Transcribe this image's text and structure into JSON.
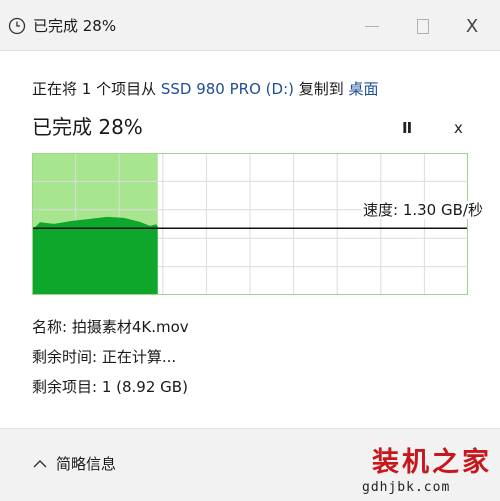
{
  "window": {
    "title": "已完成 28%",
    "minimize_icon": "minimize-icon",
    "maximize_icon": "maximize-icon",
    "close_glyph": "X"
  },
  "copy": {
    "prefix": "正在将 1 个项目从 ",
    "source": "SSD 980 PRO (D:)",
    "middle": " 复制到 ",
    "destination": "桌面"
  },
  "status": {
    "title": "已完成 28%",
    "pause_glyph": "II",
    "cancel_glyph": "x",
    "percent_complete": 28
  },
  "graph": {
    "speed_label": "速度: 1.30 GB/秒",
    "fill_color": "#0fa72b",
    "history_color": "#a8e58f",
    "current_speed_level": 0.47,
    "history_peak_level": 0.55
  },
  "details": {
    "name_label": "名称: ",
    "name_value": "拍摄素材4K.mov",
    "time_label": "剩余时间: ",
    "time_value": "正在计算...",
    "items_label": "剩余项目: ",
    "items_value": "1 (8.92 GB)"
  },
  "footer": {
    "less_info": "简略信息",
    "icon": "chevron-up-icon"
  },
  "watermark": {
    "text": "装机之家",
    "url": "gdhjbk.com"
  }
}
